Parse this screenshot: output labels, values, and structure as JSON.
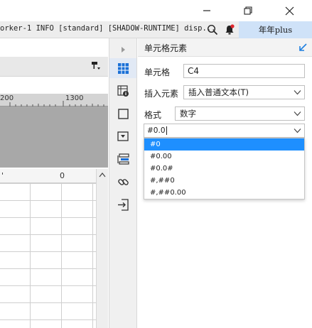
{
  "window": {
    "minimize_icon": "minimize-icon",
    "maximize_icon": "maximize-icon",
    "close_icon": "close-icon"
  },
  "logbar": {
    "text": "orker-1 INFO [standard] [SHADOW-RUNTIME] disp...",
    "user": "年年plus",
    "notification_color": "#e0252b"
  },
  "workspace": {
    "ruler_labels": [
      "200",
      "1300"
    ],
    "column_headers": [
      "'",
      "0"
    ]
  },
  "icon_strip": {
    "items": [
      "cell-properties-icon",
      "cell-element-icon",
      "border-icon",
      "widget-icon",
      "stacked-list-icon",
      "hyperlink-icon",
      "import-icon"
    ],
    "active_index": 0
  },
  "panel": {
    "title": "单元格元素",
    "cell_label": "单元格",
    "cell_value": "C4",
    "insert_label": "插入元素",
    "insert_value": "插入普通文本(T)",
    "format_label": "格式",
    "format_value": "数字",
    "pattern_value": "#0.0",
    "pattern_options": [
      "#0",
      "#0.00",
      "#0.0#",
      "#,##0",
      "#,##0.00"
    ],
    "selected_option": 0
  },
  "colors": {
    "accent": "#1e8fff",
    "user_chip": "#cfe2f8",
    "active_strip": "#e1e9f5"
  }
}
